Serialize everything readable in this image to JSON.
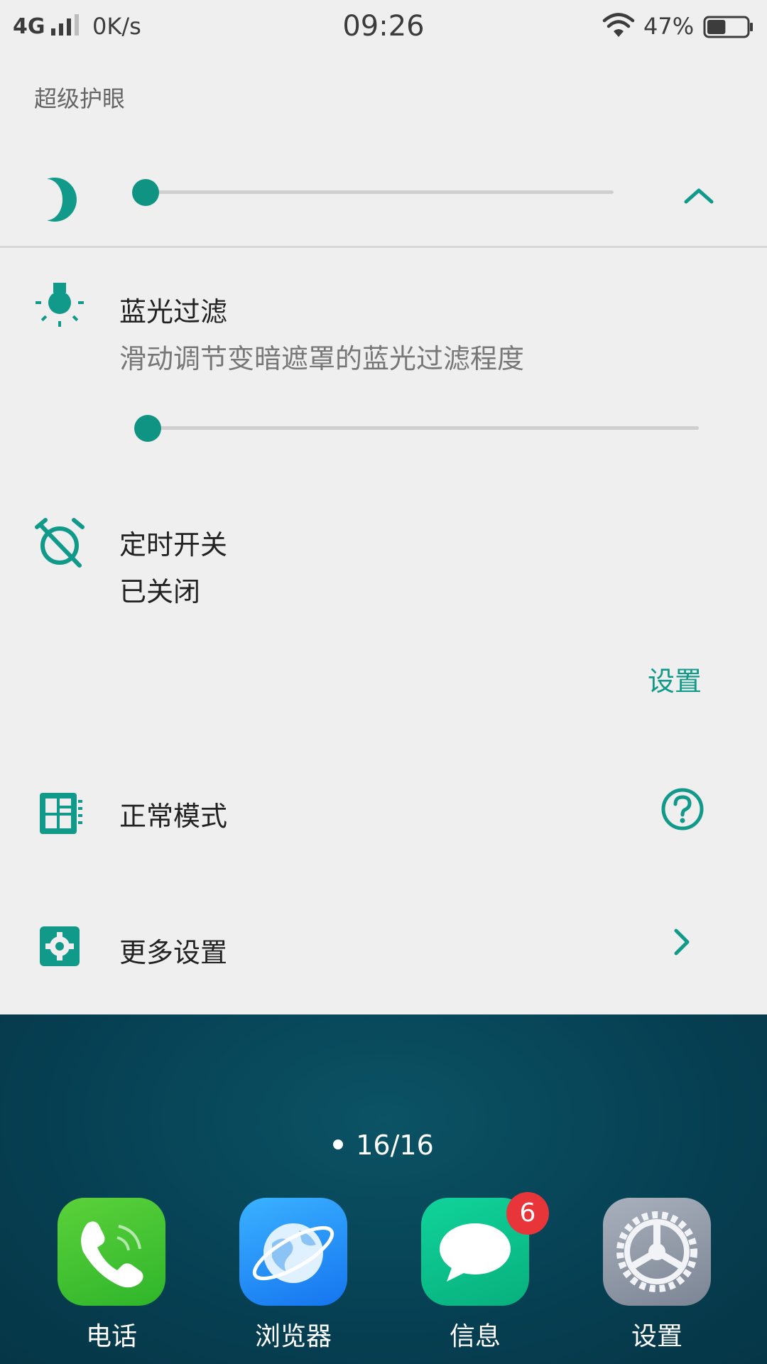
{
  "status_bar": {
    "network": "4G",
    "speed": "0K/s",
    "time": "09:26",
    "battery": "47%",
    "battery_level": 0.47
  },
  "panel": {
    "title": "超级护眼",
    "brightness_level": 0.02,
    "blue_light": {
      "title": "蓝光过滤",
      "subtitle": "滑动调节变暗遮罩的蓝光过滤程度",
      "level": 0.02
    },
    "timer": {
      "title": "定时开关",
      "status": "已关闭",
      "action_label": "设置"
    },
    "mode": {
      "title": "正常模式"
    },
    "more": {
      "title": "更多设置"
    }
  },
  "home": {
    "page_indicator": "16/16",
    "dock": [
      {
        "label": "电话",
        "icon": "phone-icon"
      },
      {
        "label": "浏览器",
        "icon": "browser-icon"
      },
      {
        "label": "信息",
        "icon": "messages-icon",
        "badge": "6"
      },
      {
        "label": "设置",
        "icon": "settings-icon"
      }
    ]
  },
  "colors": {
    "accent": "#11998a",
    "panel_bg": "#efefef",
    "home_bg": "#063f52",
    "badge": "#e8353a"
  }
}
